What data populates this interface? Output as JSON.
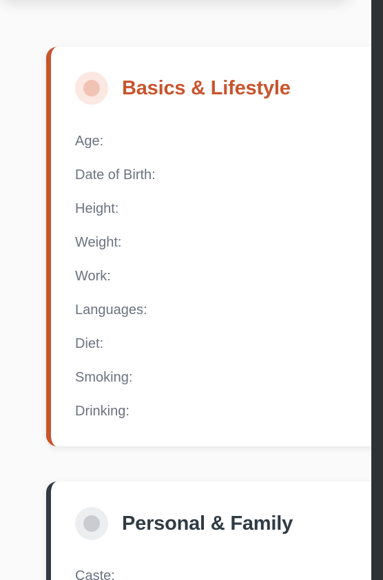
{
  "cards": {
    "basics": {
      "title": "Basics & Lifestyle",
      "accent_color": "#c9542c",
      "fields": [
        {
          "label": "Age:"
        },
        {
          "label": "Date of Birth:"
        },
        {
          "label": "Height:"
        },
        {
          "label": "Weight:"
        },
        {
          "label": "Work:"
        },
        {
          "label": "Languages:"
        },
        {
          "label": "Diet:"
        },
        {
          "label": "Smoking:"
        },
        {
          "label": "Drinking:"
        }
      ]
    },
    "personal": {
      "title": "Personal & Family",
      "accent_color": "#2f3b45",
      "fields": [
        {
          "label": "Caste:"
        }
      ]
    }
  }
}
